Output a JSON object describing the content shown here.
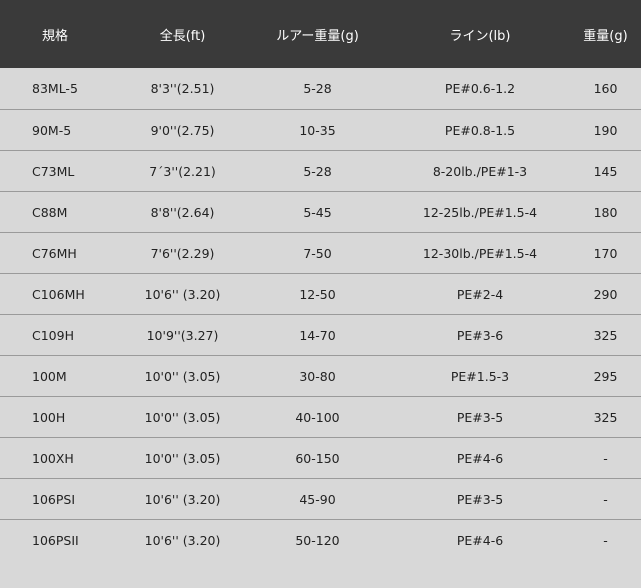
{
  "table": {
    "headers": {
      "model": "規格",
      "length": "全長(ft)",
      "lure_weight": "ルアー重量(g)",
      "line": "ライン(lb)",
      "weight": "重量(g)"
    },
    "rows": [
      {
        "model": "83ML-5",
        "length": "8'3''(2.51)",
        "lure_weight": "5-28",
        "line": "PE#0.6-1.2",
        "weight": "160"
      },
      {
        "model": "90M-5",
        "length": "9'0''(2.75)",
        "lure_weight": "10-35",
        "line": "PE#0.8-1.5",
        "weight": "190"
      },
      {
        "model": "C73ML",
        "length": "7´3''(2.21)",
        "lure_weight": "5-28",
        "line": "8-20lb./PE#1-3",
        "weight": "145"
      },
      {
        "model": "C88M",
        "length": "8'8''(2.64)",
        "lure_weight": "5-45",
        "line": "12-25lb./PE#1.5-4",
        "weight": "180"
      },
      {
        "model": "C76MH",
        "length": "7'6''(2.29)",
        "lure_weight": "7-50",
        "line": "12-30lb./PE#1.5-4",
        "weight": "170"
      },
      {
        "model": "C106MH",
        "length": "10'6'' (3.20)",
        "lure_weight": "12-50",
        "line": "PE#2-4",
        "weight": "290"
      },
      {
        "model": "C109H",
        "length": "10'9''(3.27)",
        "lure_weight": "14-70",
        "line": "PE#3-6",
        "weight": "325"
      },
      {
        "model": "100M",
        "length": "10'0'' (3.05)",
        "lure_weight": "30-80",
        "line": "PE#1.5-3",
        "weight": "295"
      },
      {
        "model": "100H",
        "length": "10'0'' (3.05)",
        "lure_weight": "40-100",
        "line": "PE#3-5",
        "weight": "325"
      },
      {
        "model": "100XH",
        "length": "10'0'' (3.05)",
        "lure_weight": "60-150",
        "line": "PE#4-6",
        "weight": "-"
      },
      {
        "model": "106PSI",
        "length": "10'6'' (3.20)",
        "lure_weight": "45-90",
        "line": "PE#3-5",
        "weight": "-"
      },
      {
        "model": "106PSII",
        "length": "10'6'' (3.20)",
        "lure_weight": "50-120",
        "line": "PE#4-6",
        "weight": "-"
      }
    ]
  }
}
